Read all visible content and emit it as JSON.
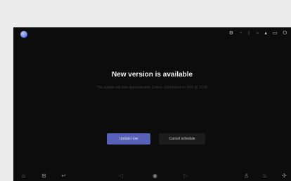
{
  "status_bar": {
    "icons": [
      "settings-icon",
      "alarm-icon",
      "bluetooth-icon",
      "wifi-icon",
      "signal-icon",
      "battery-icon",
      "power-icon"
    ]
  },
  "dialog": {
    "title": "New version is available",
    "subtitle": "The update will take approximately 3 mins. Scheduled on 25/6 @ 10:00",
    "update_button": "Update now",
    "cancel_button": "Cancel schedule"
  },
  "colors": {
    "screen_bg": "#0c0c0c",
    "primary_button": "#5861b8",
    "secondary_button": "#1c1c1c"
  },
  "nav_bar": {
    "icons": [
      "home-icon",
      "apps-icon",
      "back-icon",
      "media-icon",
      "mic-icon",
      "music-icon",
      "user-icon",
      "temperature-icon",
      "fan-icon"
    ]
  }
}
